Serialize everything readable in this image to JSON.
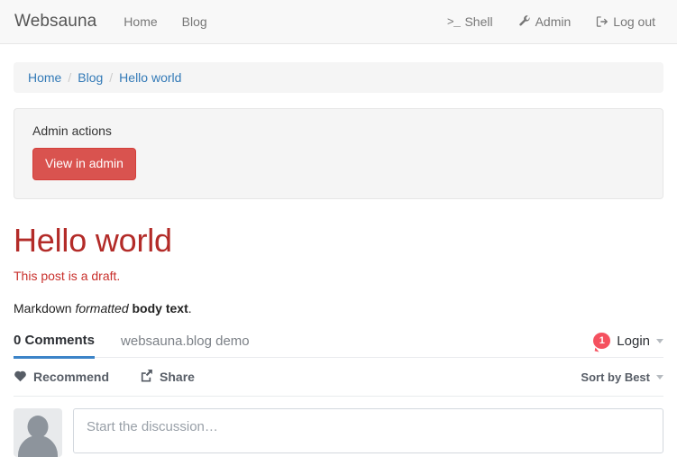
{
  "navbar": {
    "brand": "Websauna",
    "left_items": [
      {
        "label": "Home",
        "icon": ""
      },
      {
        "label": "Blog",
        "icon": ""
      }
    ],
    "right_items": [
      {
        "label": "Shell",
        "icon": "terminal-icon",
        "glyph": ">_"
      },
      {
        "label": "Admin",
        "icon": "wrench-icon"
      },
      {
        "label": "Log out",
        "icon": "sign-out-icon"
      }
    ]
  },
  "breadcrumb": {
    "separator": "/",
    "items": [
      {
        "label": "Home"
      },
      {
        "label": "Blog"
      },
      {
        "label": "Hello world"
      }
    ]
  },
  "admin_panel": {
    "label": "Admin actions",
    "button_label": "View in admin",
    "button_color": "#d9534f"
  },
  "post": {
    "title": "Hello world",
    "title_color": "#b32b28",
    "draft_notice": "This post is a draft.",
    "draft_color": "#c9302c",
    "body_lead": "Markdown ",
    "body_em": "formatted",
    "body_mid": " ",
    "body_strong": "body text",
    "body_tail": "."
  },
  "disqus": {
    "comments_tab": "0 Comments",
    "site_tab": "websauna.blog demo",
    "active_tab_color": "#3c84c8",
    "notification_count": "1",
    "notification_color": "#f5515f",
    "login_label": "Login",
    "recommend_label": "Recommend",
    "share_label": "Share",
    "sort_label": "Sort by Best",
    "compose_placeholder": "Start the discussion…"
  }
}
